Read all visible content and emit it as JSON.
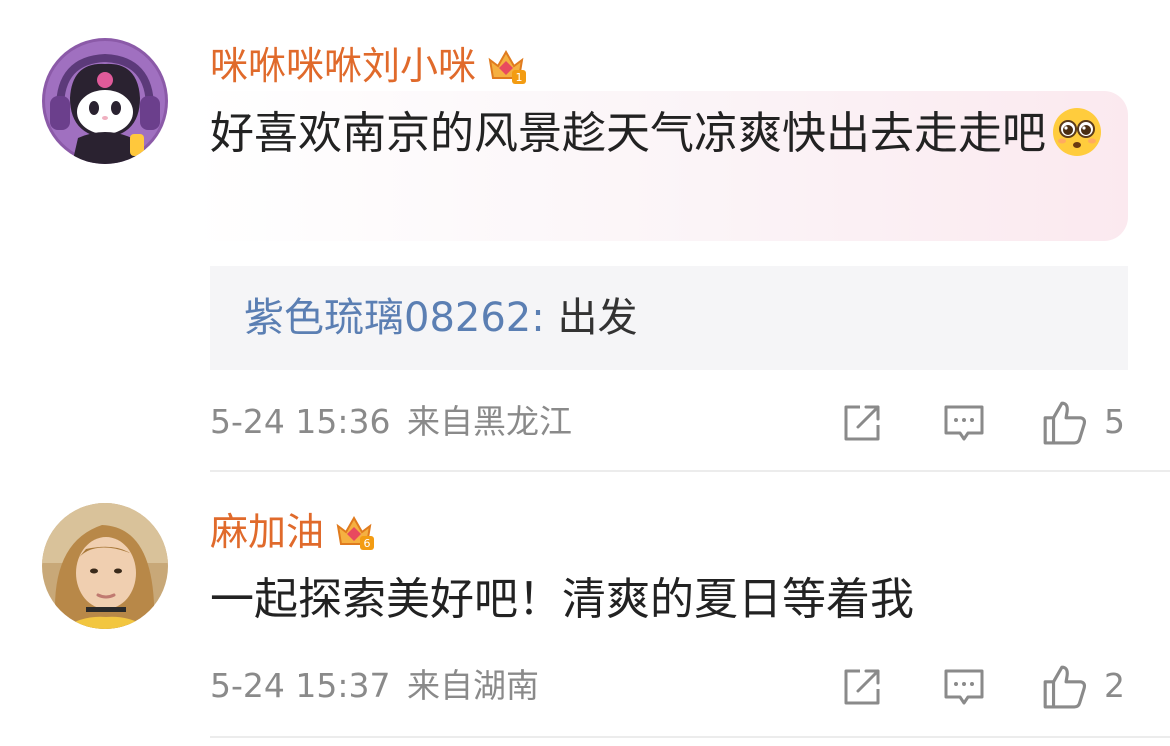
{
  "comments": [
    {
      "username": "咪咻咪咻刘小咪",
      "username_color": "#e06a2b",
      "badge_level": "1",
      "text": "好喜欢南京的风景趁天气凉爽快出去走走吧",
      "emoji": "pleading-face",
      "reply": {
        "author": "紫色琉璃08262",
        "separator": ":",
        "text": "出发"
      },
      "time": "5-24 15:36",
      "location": "来自黑龙江",
      "likes": "5"
    },
    {
      "username": "麻加油",
      "username_color": "#e06a2b",
      "badge_level": "6",
      "text": "一起探索美好吧！清爽的夏日等着我",
      "time": "5-24 15:37",
      "location": "来自湖南",
      "likes": "2"
    }
  ],
  "icons": {
    "share": "share-icon",
    "comment": "comment-icon",
    "like": "thumbs-up-icon"
  },
  "colors": {
    "accent_orange": "#e06a2b",
    "reply_blue": "#5b7fb3",
    "meta_gray": "#8a8a8a"
  }
}
